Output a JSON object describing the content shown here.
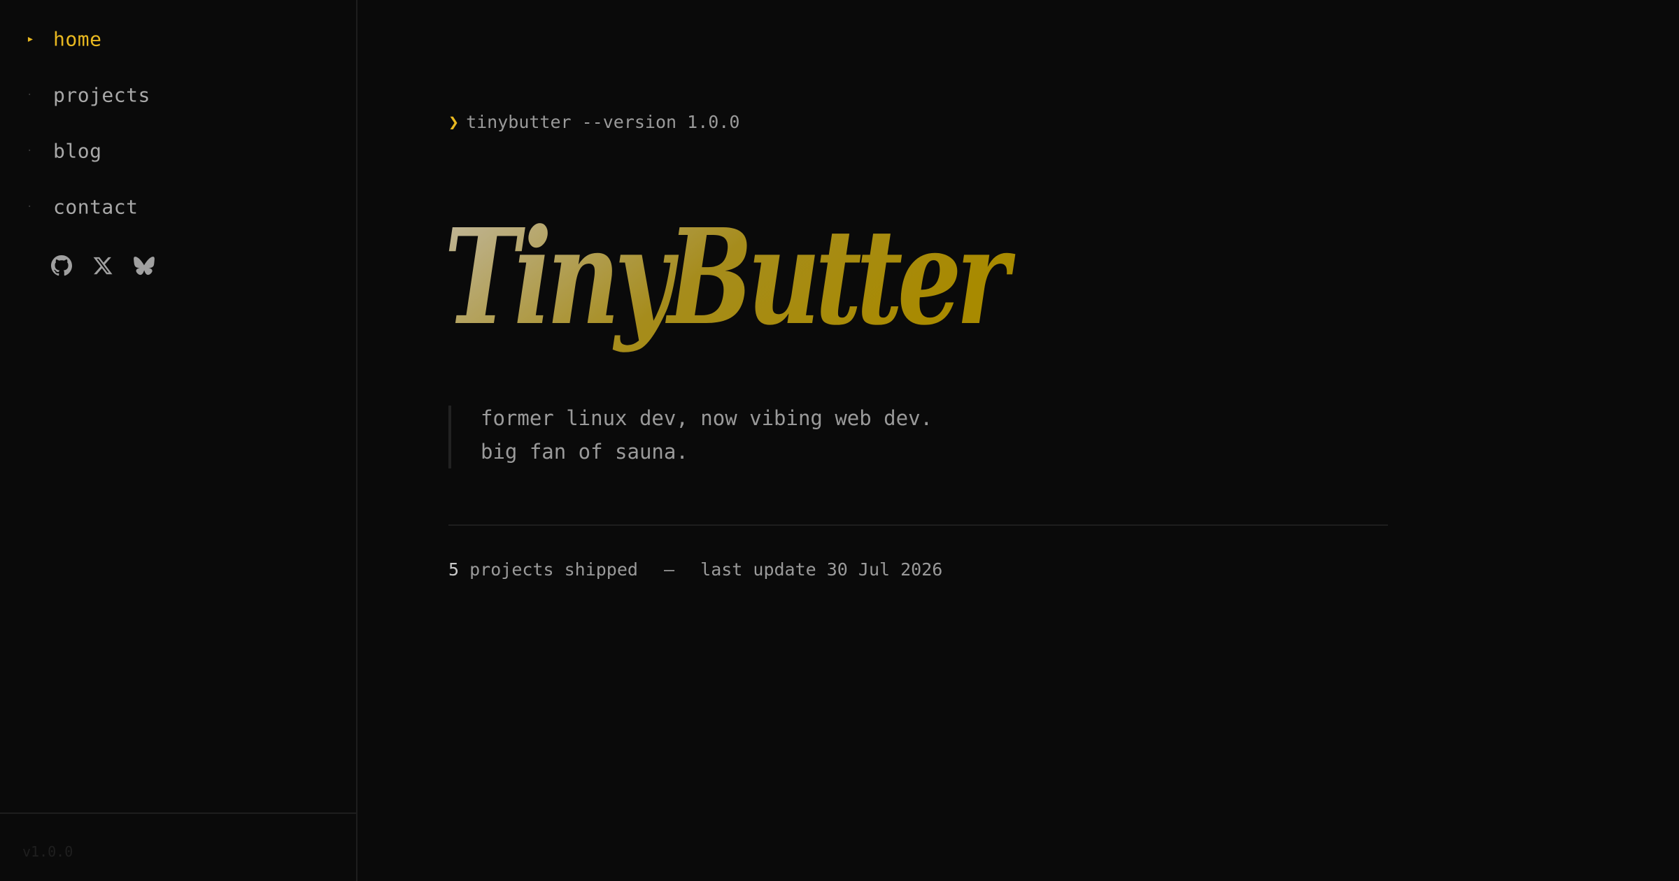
{
  "sidebar": {
    "nav": [
      {
        "label": "home",
        "active": true
      },
      {
        "label": "projects",
        "active": false
      },
      {
        "label": "blog",
        "active": false
      },
      {
        "label": "contact",
        "active": false
      }
    ],
    "active_marker": "▸",
    "inactive_marker": "·",
    "socials": [
      {
        "icon": "github-icon"
      },
      {
        "icon": "x-icon"
      },
      {
        "icon": "bluesky-icon"
      }
    ],
    "version": "v1.0.0"
  },
  "main": {
    "prompt": {
      "caret": "❯",
      "command": "tinybutter --version 1.0.0"
    },
    "hero_title": "TinyButter",
    "bio": [
      "former linux dev, now vibing web dev.",
      "big fan of sauna."
    ],
    "stats": {
      "count": "5",
      "count_label": "projects shipped",
      "separator": "—",
      "update": "last update 30 Jul 2026"
    }
  },
  "colors": {
    "accent": "#e8b820",
    "background": "#0a0a0a",
    "text": "#a8a8a8",
    "hero_gradient_start": "#bdb39a",
    "hero_gradient_end": "#a88a00"
  }
}
